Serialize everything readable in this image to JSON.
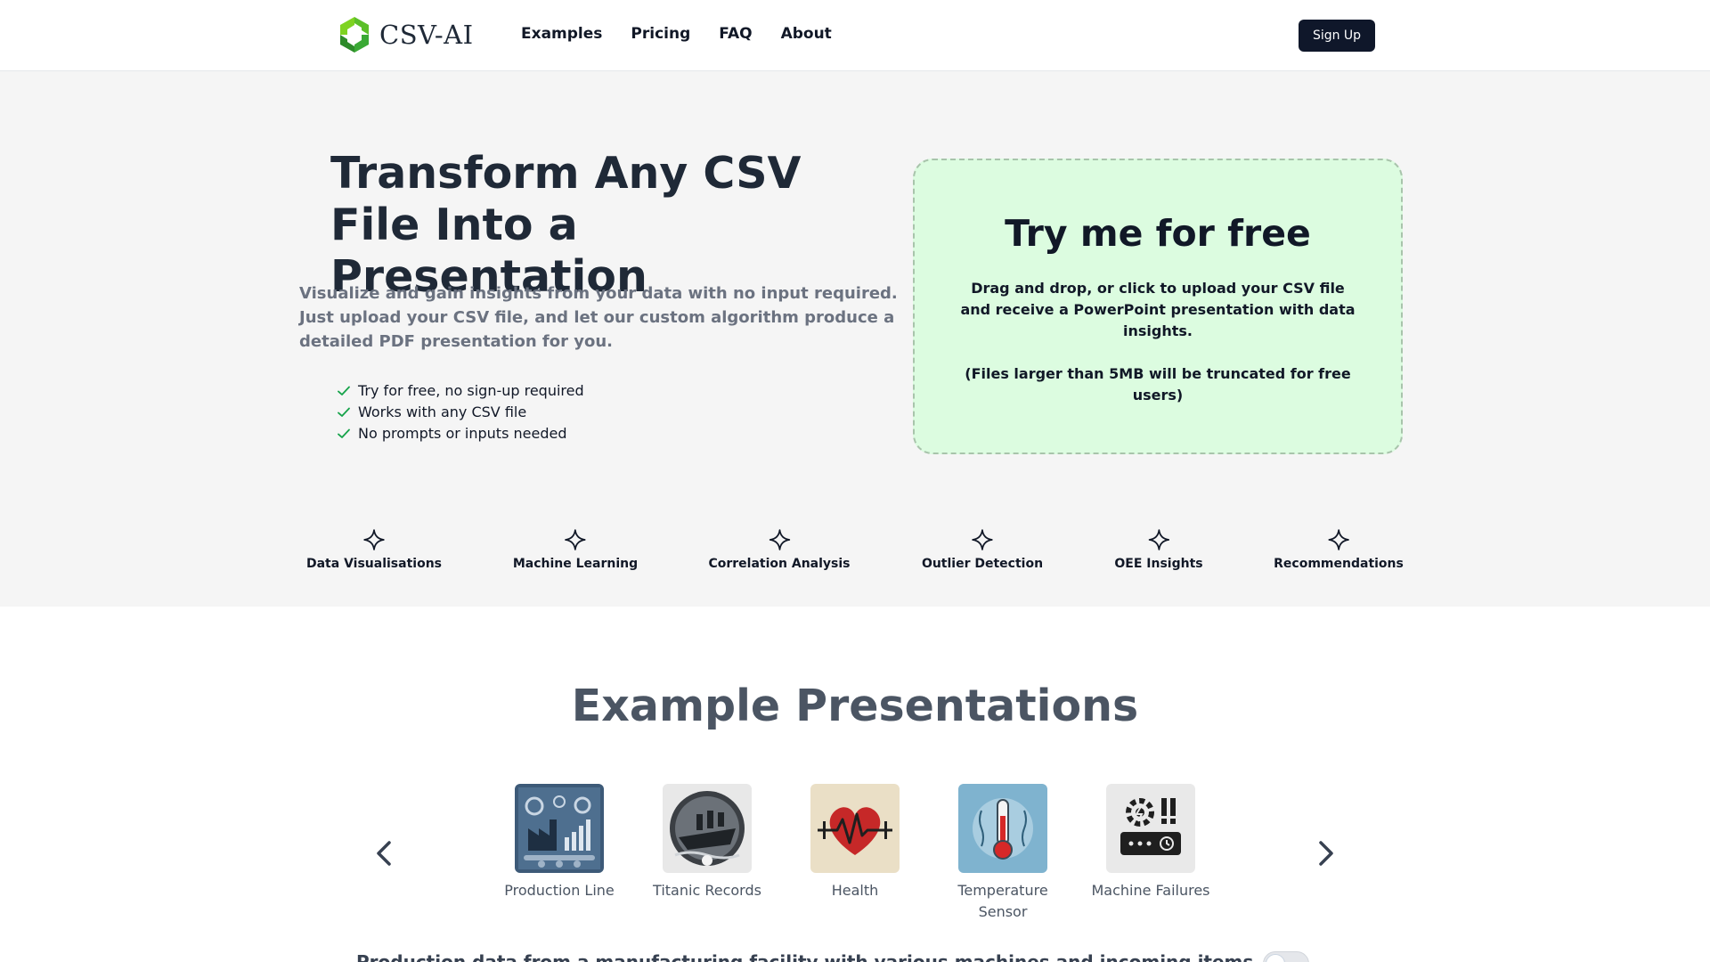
{
  "brand": {
    "name": "CSV-AI"
  },
  "nav": {
    "items": [
      {
        "label": "Examples"
      },
      {
        "label": "Pricing"
      },
      {
        "label": "FAQ"
      },
      {
        "label": "About"
      }
    ],
    "signup_label": "Sign Up"
  },
  "hero": {
    "title": "Transform Any CSV File Into a Presentation",
    "description": "Visualize and gain insights from your data with no input required. Just upload your CSV file, and let our custom algorithm produce a detailed PDF presentation for you.",
    "checklist": [
      "Try for free, no sign-up required",
      "Works with any CSV file",
      "No prompts or inputs needed"
    ]
  },
  "upload": {
    "title": "Try me for free",
    "text": "Drag and drop, or click to upload your CSV file and receive a PowerPoint presentation with data insights.",
    "note": "(Files larger than 5MB will be truncated for free users)"
  },
  "features": [
    {
      "label": "Data Visualisations",
      "icon": "sparkle-icon"
    },
    {
      "label": "Machine Learning",
      "icon": "sparkle-icon"
    },
    {
      "label": "Correlation Analysis",
      "icon": "sparkle-icon"
    },
    {
      "label": "Outlier Detection",
      "icon": "sparkle-icon"
    },
    {
      "label": "OEE Insights",
      "icon": "sparkle-icon"
    },
    {
      "label": "Recommendations",
      "icon": "sparkle-icon"
    }
  ],
  "examples": {
    "title": "Example Presentations",
    "items": [
      {
        "label": "Production Line",
        "icon": "factory-icon"
      },
      {
        "label": "Titanic Records",
        "icon": "ship-icon"
      },
      {
        "label": "Health",
        "icon": "heart-pulse-icon"
      },
      {
        "label": "Temperature Sensor",
        "icon": "thermometer-icon"
      },
      {
        "label": "Machine Failures",
        "icon": "machine-alert-icon"
      }
    ],
    "active_description": "Production data from a manufacturing facility with various machines and incoming items"
  },
  "colors": {
    "brand_green": "#3aa935",
    "dropzone_bg": "#dcfce0",
    "button_dark": "#0f172a",
    "check_green": "#16a34a"
  }
}
